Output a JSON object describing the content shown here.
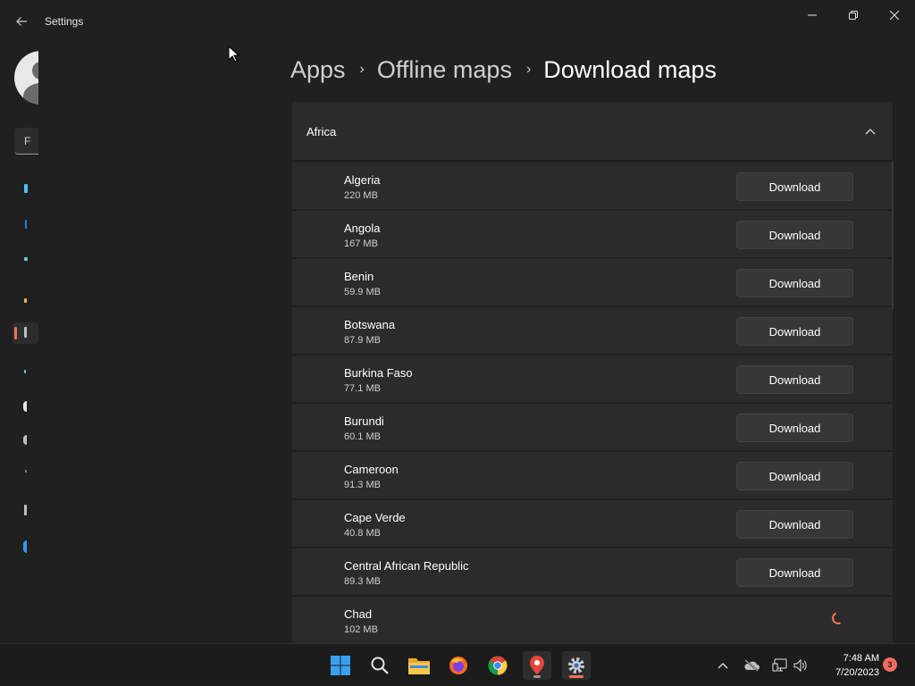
{
  "window": {
    "title": "Settings",
    "back_icon": "back-arrow-icon",
    "minimize_icon": "minimize-icon",
    "maximize_icon": "restore-icon",
    "close_icon": "close-icon"
  },
  "sidebar": {
    "search_placeholder": "F"
  },
  "breadcrumb": {
    "items": [
      "Apps",
      "Offline maps",
      "Download maps"
    ]
  },
  "region": {
    "title": "Africa",
    "expanded": true,
    "button_label": "Download",
    "countries": [
      {
        "name": "Algeria",
        "size": "220 MB",
        "state": "download"
      },
      {
        "name": "Angola",
        "size": "167 MB",
        "state": "download"
      },
      {
        "name": "Benin",
        "size": "59.9 MB",
        "state": "download"
      },
      {
        "name": "Botswana",
        "size": "87.9 MB",
        "state": "download"
      },
      {
        "name": "Burkina Faso",
        "size": "77.1 MB",
        "state": "download"
      },
      {
        "name": "Burundi",
        "size": "60.1 MB",
        "state": "download"
      },
      {
        "name": "Cameroon",
        "size": "91.3 MB",
        "state": "download"
      },
      {
        "name": "Cape Verde",
        "size": "40.8 MB",
        "state": "download"
      },
      {
        "name": "Central African Republic",
        "size": "89.3 MB",
        "state": "download"
      },
      {
        "name": "Chad",
        "size": "102 MB",
        "state": "downloading"
      }
    ]
  },
  "taskbar": {
    "apps": [
      "start-icon",
      "search-icon",
      "file-explorer-icon",
      "firefox-icon",
      "chrome-icon",
      "maps-icon",
      "settings-icon"
    ],
    "time": "7:48 AM",
    "date": "7/20/2023",
    "notification_count": "3"
  },
  "colors": {
    "background": "#202020",
    "card": "#2b2b2b",
    "accent": "#f1745a"
  }
}
